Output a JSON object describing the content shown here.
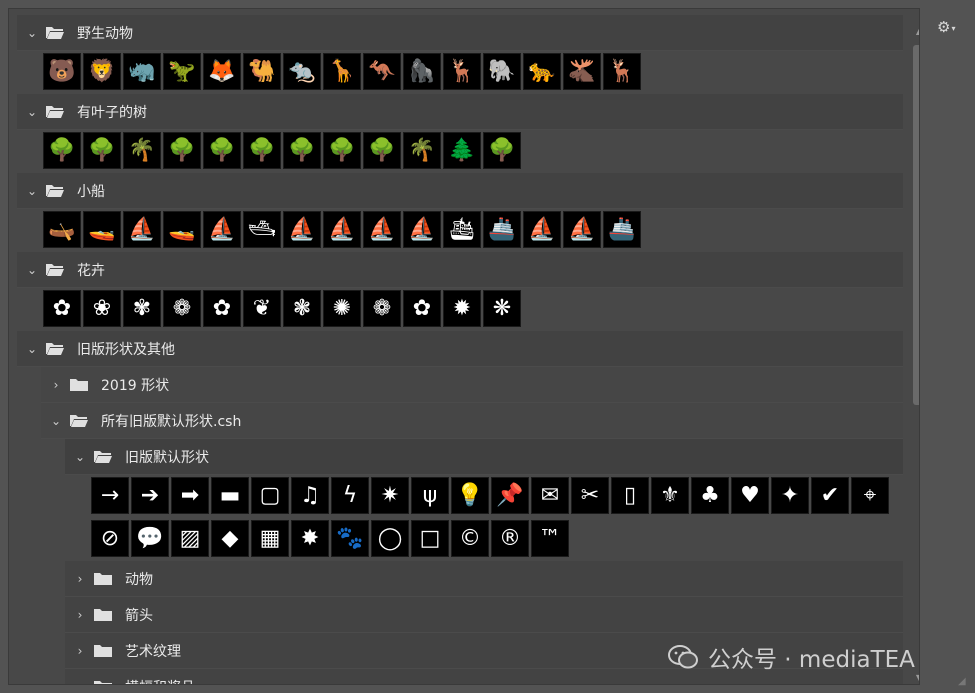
{
  "groups": [
    {
      "label": "野生动物",
      "expanded": true,
      "icons": [
        "🐻",
        "🦁",
        "🦏",
        "🦖",
        "🦊",
        "🐫",
        "🐀",
        "🦒",
        "🦘",
        "🦍",
        "🦌",
        "🐘",
        "🐆",
        "🫎",
        "🦌"
      ]
    },
    {
      "label": "有叶子的树",
      "expanded": true,
      "icons": [
        "🌳",
        "🌳",
        "🌴",
        "🌳",
        "🌳",
        "🌳",
        "🌳",
        "🌳",
        "🌳",
        "🌴",
        "🌲",
        "🌳"
      ]
    },
    {
      "label": "小船",
      "expanded": true,
      "icons": [
        "🛶",
        "🚤",
        "⛵",
        "🚤",
        "⛵",
        "🛥",
        "⛵",
        "⛵",
        "⛵",
        "⛵",
        "🛳",
        "🚢",
        "⛵",
        "⛵",
        "🚢"
      ]
    },
    {
      "label": "花卉",
      "expanded": true,
      "icons": [
        "✿",
        "❀",
        "✾",
        "❁",
        "✿",
        "❦",
        "❃",
        "✺",
        "❁",
        "✿",
        "✹",
        "❋"
      ]
    }
  ],
  "legacy": {
    "label": "旧版形状及其他",
    "sub_2019": "2019 形状",
    "csh_label": "所有旧版默认形状.csh",
    "default_label": "旧版默认形状",
    "default_icons_row1": [
      "→",
      "➔",
      "➡",
      "▬",
      "▢",
      "♫",
      "ϟ",
      "✷",
      "ψ",
      "💡",
      "📌",
      "✉",
      "✂",
      "▯",
      "⚜",
      "♣",
      "♥",
      "✦",
      "✔",
      "⌖"
    ],
    "default_icons_row2": [
      "⊘",
      "💬",
      "▨",
      "◆",
      "▦",
      "✸",
      "🐾",
      "◯",
      "□",
      "©",
      "®",
      "™"
    ],
    "children": [
      "动物",
      "箭头",
      "艺术纹理",
      "横幅和奖品"
    ]
  },
  "watermark": "公众号 · mediaTEA",
  "gear_icon": "gear-icon"
}
